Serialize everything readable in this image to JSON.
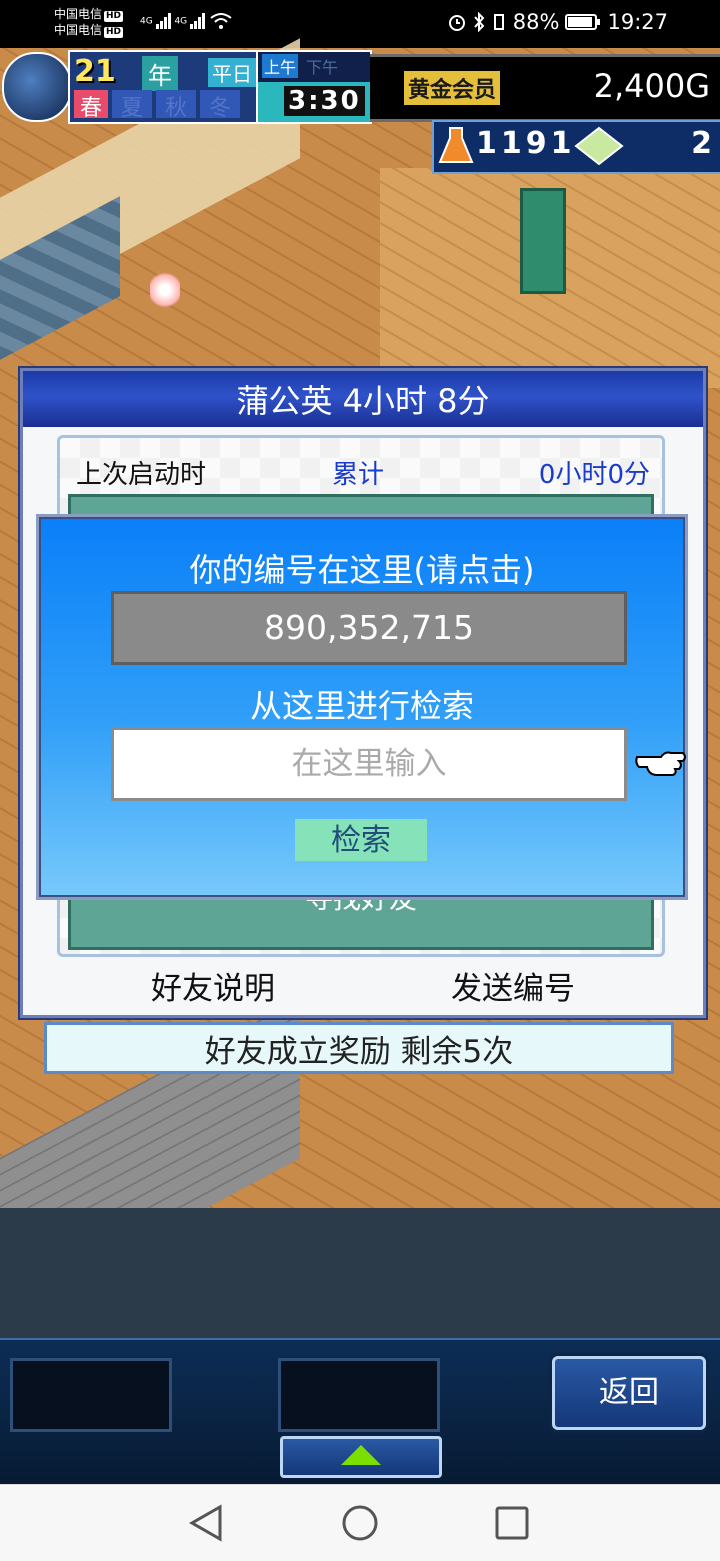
{
  "status_bar": {
    "carrier1": "中国电信",
    "carrier2": "中国电信",
    "hd": "HD",
    "net1": "4G",
    "net2": "4G",
    "battery": "88%",
    "time": "19:27"
  },
  "hud": {
    "year_num": "21",
    "year_unit": "年",
    "day_type": "平日",
    "season_active": "春",
    "seasons_other": [
      "夏",
      "秋",
      "冬"
    ],
    "am": "上午",
    "pm": "下午",
    "clock": "3:30",
    "membership": "黄金会员",
    "gold": "2,400G",
    "research_points": "1191",
    "tickets": "2"
  },
  "panel": {
    "title": "蒲公英  4小时 8分",
    "last_launch_label": "上次启动时",
    "cumulative_label": "累计",
    "cumulative_value": "0小时0分",
    "find_friend_label": "寻找好友",
    "friend_help_button": "好友说明",
    "send_id_button": "发送编号",
    "reward_text": "好友成立奖励  剩余5次"
  },
  "dialog": {
    "id_caption": "你的编号在这里(请点击)",
    "id_value": "890,352,715",
    "search_caption": "从这里进行检索",
    "search_placeholder": "在这里输入",
    "search_button": "检索"
  },
  "toolbar": {
    "back_button": "返回"
  },
  "colors": {
    "dialog_top": "#0a7ff8",
    "dialog_bottom": "#78c9fb",
    "search_button_bg": "#86e3b9",
    "panel_title_bg": "#2f52c9"
  }
}
